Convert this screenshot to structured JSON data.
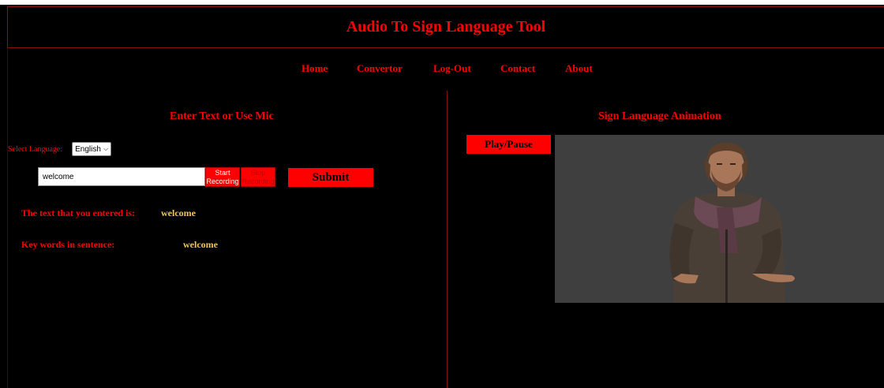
{
  "app": {
    "title": "Audio To Sign Language Tool"
  },
  "nav": {
    "items": [
      "Home",
      "Convertor",
      "Log-Out",
      "Contact",
      "About"
    ]
  },
  "left": {
    "title": "Enter Text or Use Mic",
    "language_label": "Select Language:",
    "language_value": "English",
    "input_value": "welcome",
    "start_recording": "Start Recording",
    "stop_recording": "Stop Recording",
    "submit": "Submit",
    "entered_label": "The text that you entered is:",
    "entered_value": "welcome",
    "keywords_label": "Key words in sentence:",
    "keywords_value": "welcome"
  },
  "right": {
    "title": "Sign Language Animation",
    "play_pause": "Play/Pause"
  },
  "colors": {
    "accent": "#ff0000",
    "background": "#000000",
    "highlight": "#f0c850",
    "video_bg": "#3f3f3f"
  },
  "icons": {
    "select_arrow": "chevron-down-icon"
  }
}
